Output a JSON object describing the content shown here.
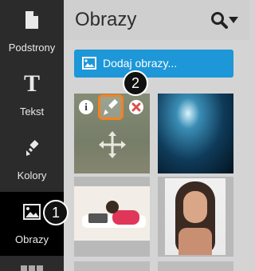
{
  "sidebar": {
    "items": [
      {
        "label": "Podstrony",
        "icon": "page-icon"
      },
      {
        "label": "Tekst",
        "icon": "text-icon"
      },
      {
        "label": "Kolory",
        "icon": "paintbrush-icon"
      },
      {
        "label": "Obrazy",
        "icon": "image-icon",
        "active": true
      }
    ]
  },
  "header": {
    "title": "Obrazy"
  },
  "add_button": {
    "label": "Dodaj obrazy..."
  },
  "callouts": {
    "one": "1",
    "two": "2"
  },
  "colors": {
    "accent": "#1d97d8",
    "highlight": "#f58220",
    "delete": "#d9534f"
  }
}
